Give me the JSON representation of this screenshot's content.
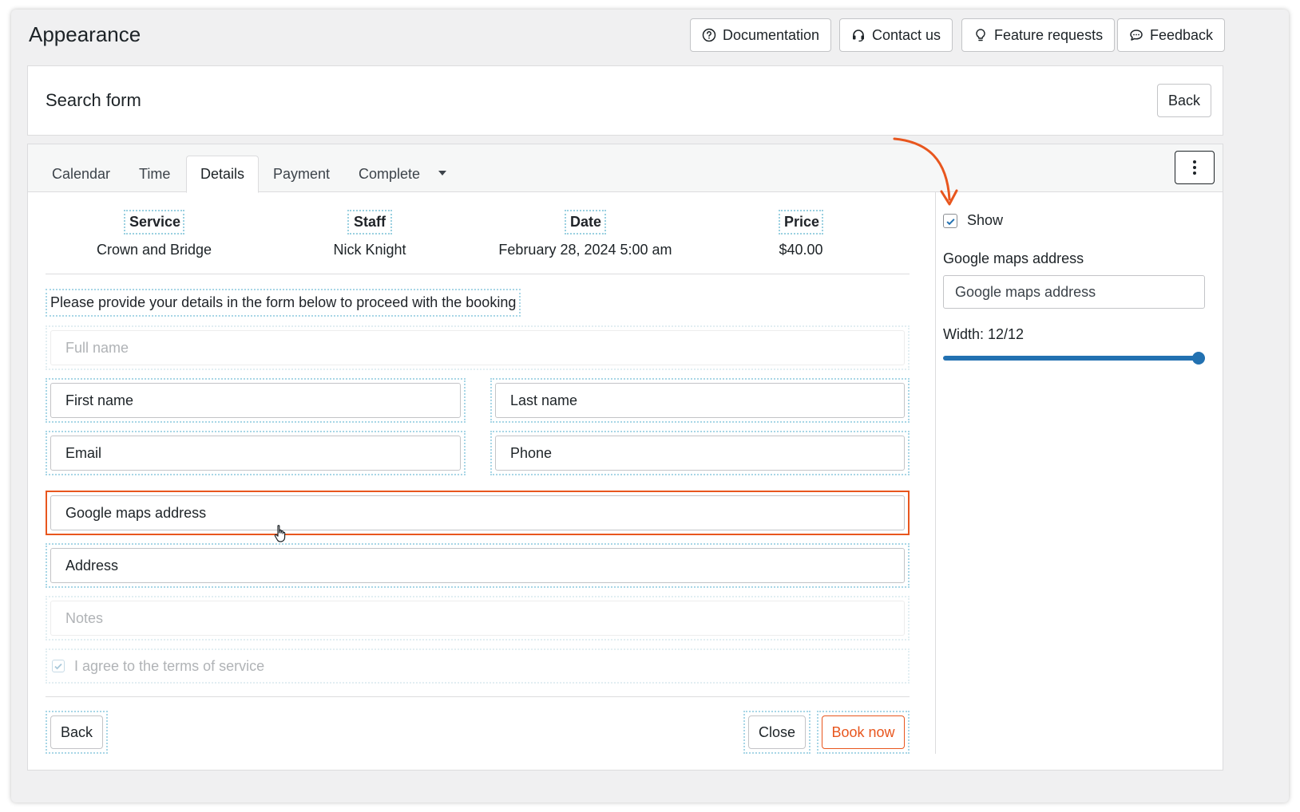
{
  "header": {
    "title": "Appearance",
    "buttons": {
      "documentation": "Documentation",
      "contact": "Contact us",
      "feature_requests": "Feature requests",
      "feedback": "Feedback"
    }
  },
  "search_form": {
    "title": "Search form",
    "back_label": "Back"
  },
  "tabs": {
    "calendar": "Calendar",
    "time": "Time",
    "details": "Details",
    "payment": "Payment",
    "complete": "Complete"
  },
  "summary": {
    "service_label": "Service",
    "service_value": "Crown and Bridge",
    "staff_label": "Staff",
    "staff_value": "Nick Knight",
    "date_label": "Date",
    "date_value": "February 28, 2024 5:00 am",
    "price_label": "Price",
    "price_value": "$40.00"
  },
  "form": {
    "intro": "Please provide your details in the form below to proceed with the booking",
    "full_name": "Full name",
    "first_name": "First name",
    "last_name": "Last name",
    "email": "Email",
    "phone": "Phone",
    "google_maps": "Google maps address",
    "address": "Address",
    "notes": "Notes",
    "terms": "I agree to the terms of service",
    "back": "Back",
    "close": "Close",
    "book_now": "Book now"
  },
  "sidebar": {
    "show_label": "Show",
    "show_checked": true,
    "field_label": "Google maps address",
    "field_value": "Google maps address",
    "width_label": "Width: 12/12",
    "width_fraction": 1.0
  },
  "colors": {
    "accent": "#e8561e",
    "slider": "#2271b1",
    "dotted_outline": "#9ad0e0"
  }
}
